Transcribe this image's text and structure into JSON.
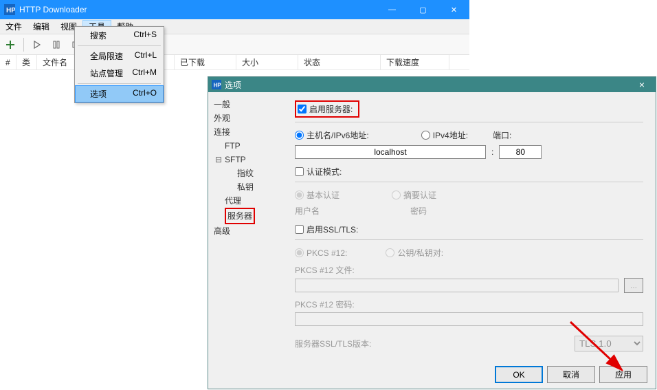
{
  "mainWindow": {
    "title": "HTTP Downloader",
    "menus": [
      "文件",
      "编辑",
      "视图",
      "工具",
      "帮助"
    ],
    "activeMenuIndex": 3,
    "columns": {
      "num": "#",
      "type": "类",
      "filename": "文件名",
      "downloaded": "已下载",
      "size": "大小",
      "status": "状态",
      "speed": "下载速度"
    }
  },
  "dropdown": {
    "items": [
      {
        "label": "搜索",
        "shortcut": "Ctrl+S"
      },
      {
        "label": "全局限速",
        "shortcut": "Ctrl+L"
      },
      {
        "label": "站点管理",
        "shortcut": "Ctrl+M"
      },
      {
        "label": "选项",
        "shortcut": "Ctrl+O"
      }
    ],
    "highlightedIndex": 3
  },
  "optionsDialog": {
    "title": "选项",
    "sidebar": {
      "general": "一般",
      "appearance": "外观",
      "connection": "连接",
      "ftp": "FTP",
      "sftp": "SFTP",
      "fingerprint": "指纹",
      "privatekey": "私钥",
      "proxy": "代理",
      "server": "服务器",
      "advanced": "高级"
    },
    "content": {
      "enableServer": "启用服务器:",
      "hostname": "主机名/IPv6地址:",
      "ipv4": "IPv4地址:",
      "port": "端口:",
      "hostValue": "localhost",
      "portSep": ":",
      "portValue": "80",
      "authMode": "认证模式:",
      "basicAuth": "基本认证",
      "digestAuth": "摘要认证",
      "username": "用户名",
      "password": "密码",
      "enableSSL": "启用SSL/TLS:",
      "pkcs12": "PKCS #12:",
      "keyPair": "公钥/私钥对:",
      "pkcs12File": "PKCS #12 文件:",
      "pkcs12Pass": "PKCS #12 密码:",
      "sslVersion": "服务器SSL/TLS版本:",
      "tlsValue": "TLS 1.0",
      "browse": "..."
    },
    "buttons": {
      "ok": "OK",
      "cancel": "取消",
      "apply": "应用"
    }
  }
}
